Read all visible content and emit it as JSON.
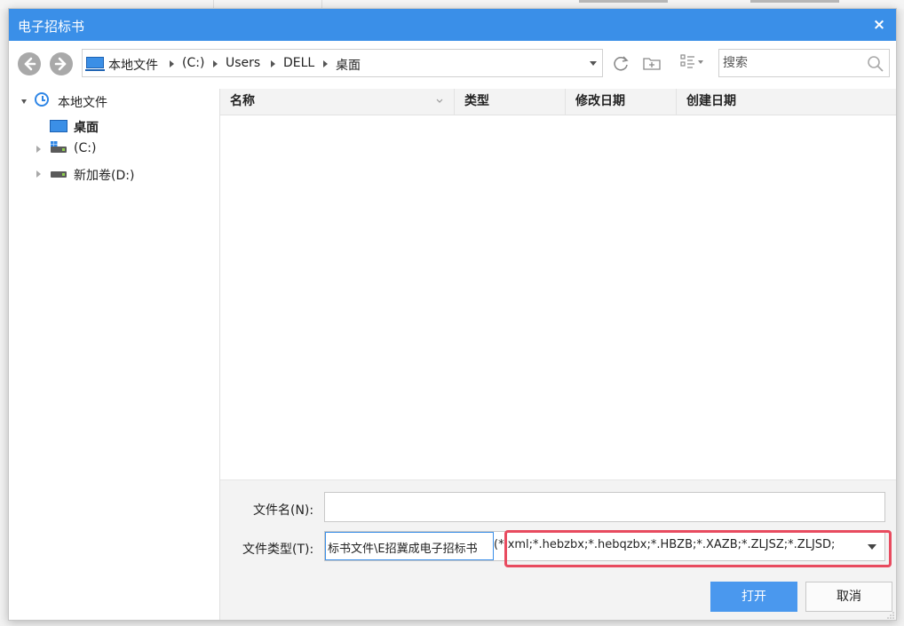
{
  "dialog": {
    "title": "电子招标书",
    "close_label": "×"
  },
  "toolbar": {
    "address": {
      "crumbs": [
        "本地文件",
        "(C:)",
        "Users",
        "DELL",
        "桌面"
      ]
    },
    "search": {
      "placeholder": "搜索"
    }
  },
  "sidebar": {
    "items": [
      {
        "label": "本地文件",
        "icon": "clock-icon",
        "expanded": true
      },
      {
        "label": "桌面",
        "icon": "desktop-icon"
      },
      {
        "label": "(C:)",
        "icon": "windows-drive-icon",
        "expanded": false
      },
      {
        "label": "新加卷(D:)",
        "icon": "drive-icon",
        "expanded": false
      }
    ]
  },
  "filelist": {
    "columns": [
      "名称",
      "类型",
      "修改日期",
      "创建日期"
    ],
    "rows": []
  },
  "form": {
    "filename_label": "文件名(N):",
    "filename_value": "",
    "filetype_label": "文件类型(T):",
    "filetype_prefix": "标书文件\\E招冀成电子招标书",
    "filetype_patterns": "(*.xml;*.hebzbx;*.hebqzbx;*.HBZB;*.XAZB;*.ZLJSZ;*.ZLJSD;"
  },
  "buttons": {
    "open": "打开",
    "cancel": "取消"
  },
  "colors": {
    "accent": "#3a8fe8",
    "highlight": "#e84b5f"
  }
}
